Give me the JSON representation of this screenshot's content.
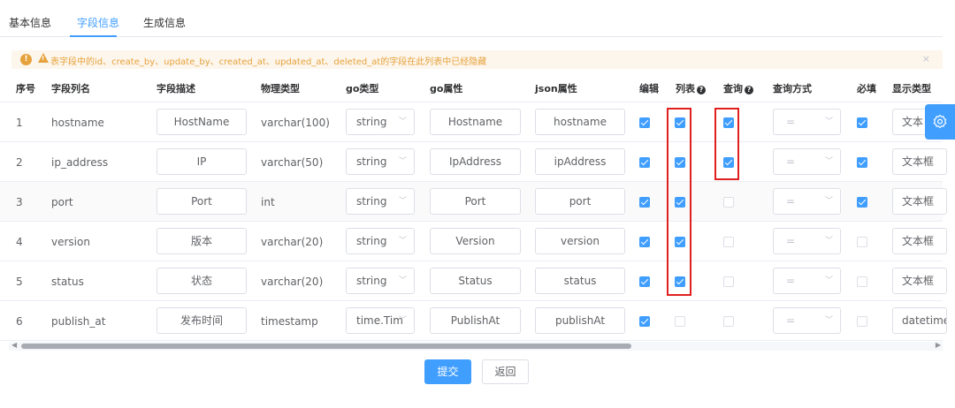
{
  "tabs": [
    "基本信息",
    "字段信息",
    "生成信息"
  ],
  "alert": {
    "text": "表字段中的id、create_by、update_by、created_at、updated_at、deleted_at的字段在此列表中已经隐藏",
    "close": "×"
  },
  "columns": [
    "序号",
    "字段列名",
    "字段描述",
    "物理类型",
    "go类型",
    "go属性",
    "json属性",
    "编辑",
    "列表",
    "查询",
    "查询方式",
    "必填",
    "显示类型"
  ],
  "rows": [
    {
      "no": "1",
      "name": "hostname",
      "desc": "HostName",
      "physical": "varchar(100)",
      "go_type": "string",
      "go_attr": "Hostname",
      "json_attr": "hostname",
      "edit": true,
      "list": true,
      "query": true,
      "query_mode": "=",
      "required": true,
      "display": "文本"
    },
    {
      "no": "2",
      "name": "ip_address",
      "desc": "IP",
      "physical": "varchar(50)",
      "go_type": "string",
      "go_attr": "IpAddress",
      "json_attr": "ipAddress",
      "edit": true,
      "list": true,
      "query": true,
      "query_mode": "=",
      "required": true,
      "display": "文本框"
    },
    {
      "no": "3",
      "name": "port",
      "desc": "Port",
      "physical": "int",
      "go_type": "string",
      "go_attr": "Port",
      "json_attr": "port",
      "edit": true,
      "list": true,
      "query": false,
      "query_mode": "=",
      "required": true,
      "display": "文本框"
    },
    {
      "no": "4",
      "name": "version",
      "desc": "版本",
      "physical": "varchar(20)",
      "go_type": "string",
      "go_attr": "Version",
      "json_attr": "version",
      "edit": true,
      "list": true,
      "query": false,
      "query_mode": "=",
      "required": false,
      "display": "文本框"
    },
    {
      "no": "5",
      "name": "status",
      "desc": "状态",
      "physical": "varchar(20)",
      "go_type": "string",
      "go_attr": "Status",
      "json_attr": "status",
      "edit": true,
      "list": true,
      "query": false,
      "query_mode": "=",
      "required": false,
      "display": "文本框"
    },
    {
      "no": "6",
      "name": "publish_at",
      "desc": "发布时间",
      "physical": "timestamp",
      "go_type": "time.Tim",
      "go_attr": "PublishAt",
      "json_attr": "publishAt",
      "edit": true,
      "list": false,
      "query": false,
      "query_mode": "=",
      "required": false,
      "display": "datetime"
    }
  ],
  "buttons": {
    "submit": "提交",
    "back": "返回"
  },
  "colors": {
    "primary": "#409eff",
    "warning": "#e6a23c",
    "highlight": "#e02020"
  },
  "icons": {
    "alert": "warning-circle-icon",
    "side": "gear-icon"
  }
}
